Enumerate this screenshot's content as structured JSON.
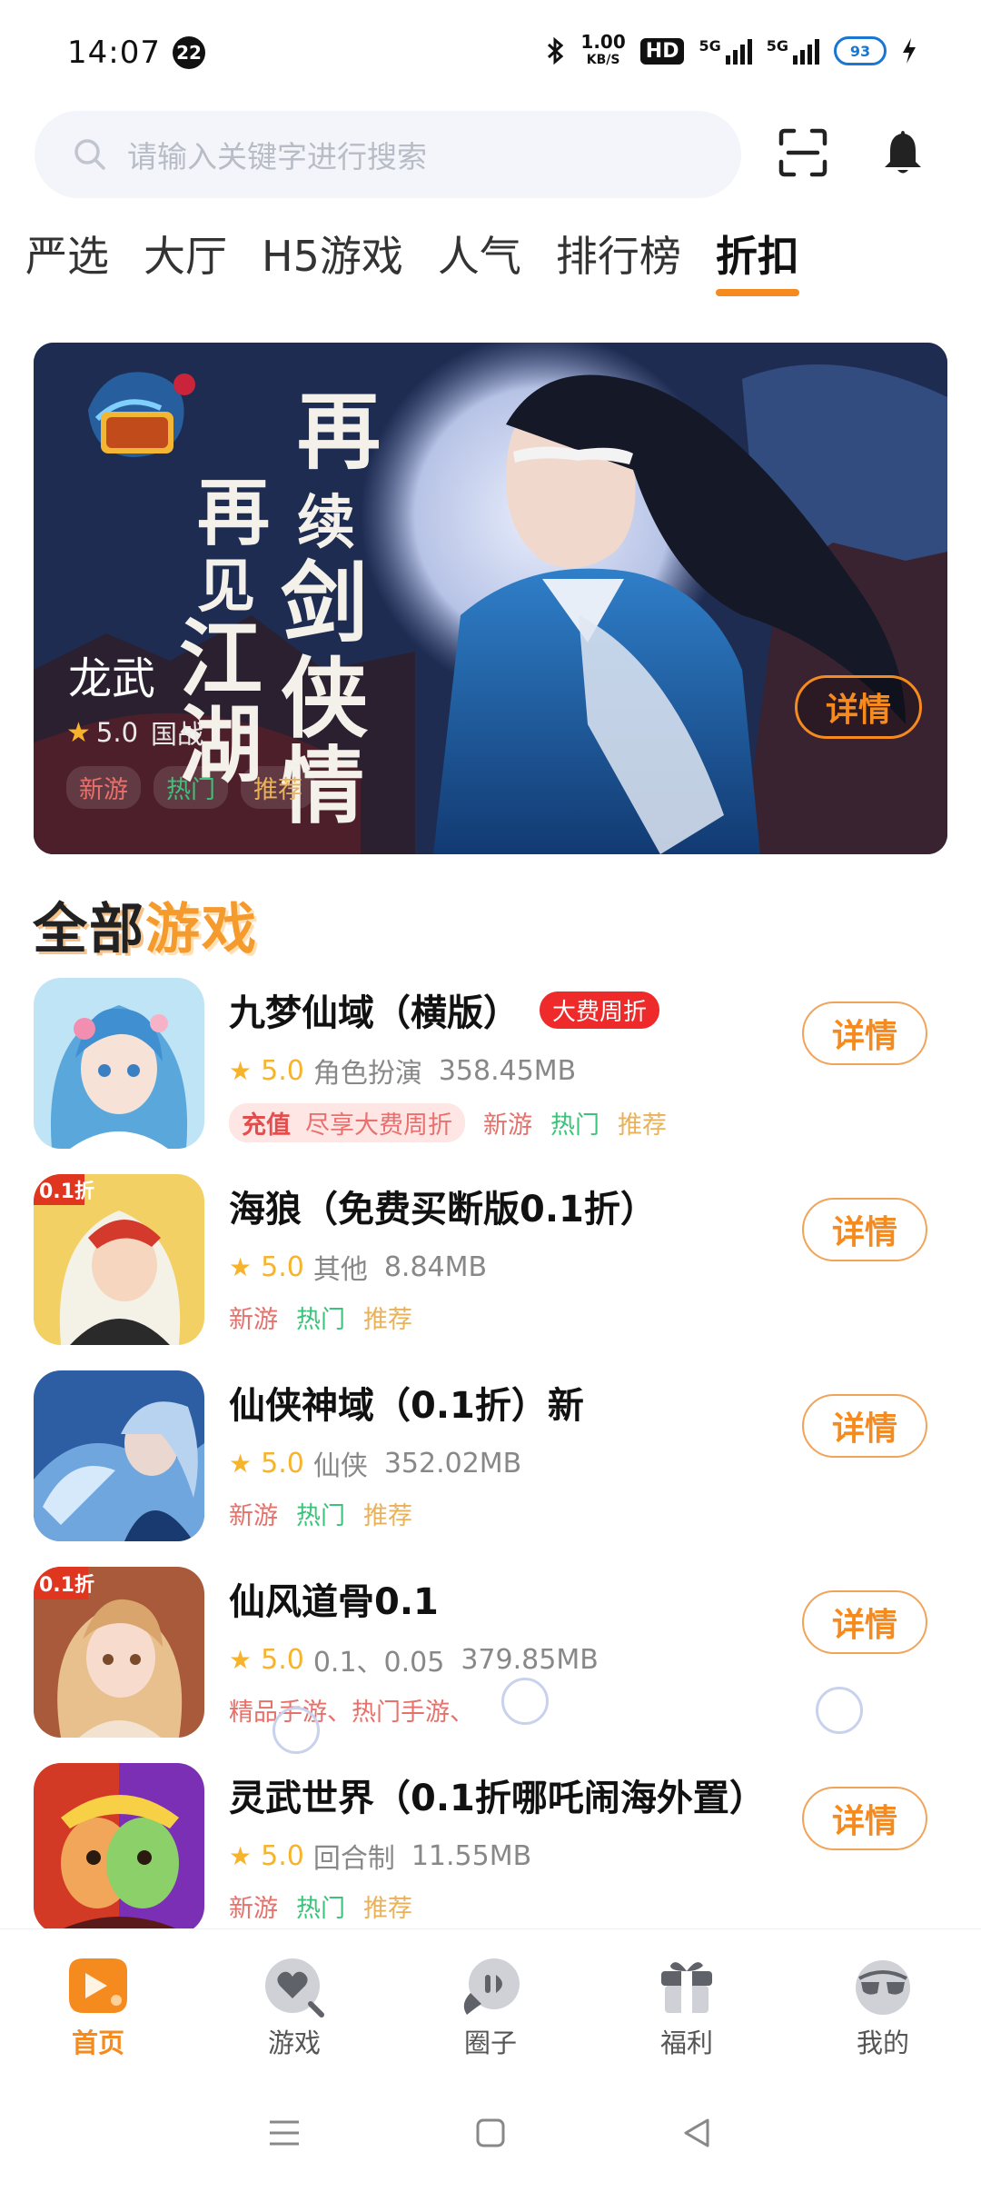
{
  "status_bar": {
    "time": "14:07",
    "notification_count": "22",
    "net_speed_value": "1.00",
    "net_speed_unit": "KB/S",
    "hd_label": "HD",
    "sig1_label": "5G",
    "sig2_label": "5G",
    "cloud_label": "93"
  },
  "search": {
    "placeholder": "请输入关键字进行搜索"
  },
  "tabs": [
    {
      "label": "严选",
      "active": false
    },
    {
      "label": "大厅",
      "active": false
    },
    {
      "label": "H5游戏",
      "active": false
    },
    {
      "label": "人气",
      "active": false
    },
    {
      "label": "排行榜",
      "active": false
    },
    {
      "label": "折扣",
      "active": true
    }
  ],
  "banner": {
    "game_name": "龙武",
    "rating": "5.0",
    "category": "国战",
    "tags": [
      "新游",
      "热门",
      "推荐"
    ],
    "detail_label": "详情"
  },
  "section": {
    "title_part1": "全部",
    "title_part2": "游戏"
  },
  "games": [
    {
      "title": "九梦仙域（横版）",
      "badge": "大费周折",
      "rating": "5.0",
      "category": "角色扮演",
      "size": "358.45MB",
      "pill_a": "充值",
      "pill_b": "尽享大费周折",
      "tags": [
        "新游",
        "热门",
        "推荐"
      ],
      "detail_label": "详情"
    },
    {
      "title": "海狼（免费买断版0.1折）",
      "rating": "5.0",
      "category": "其他",
      "size": "8.84MB",
      "tags": [
        "新游",
        "热门",
        "推荐"
      ],
      "detail_label": "详情"
    },
    {
      "title": "仙侠神域（0.1折）新",
      "rating": "5.0",
      "category": "仙侠",
      "size": "352.02MB",
      "tags": [
        "新游",
        "热门",
        "推荐"
      ],
      "detail_label": "详情"
    },
    {
      "title": "仙风道骨0.1",
      "rating": "5.0",
      "category": "0.1、0.05",
      "size": "379.85MB",
      "plain_tags": "精品手游、热门手游、",
      "detail_label": "详情"
    },
    {
      "title": "灵武世界（0.1折哪吒闹海外置）",
      "rating": "5.0",
      "category": "回合制",
      "size": "11.55MB",
      "tags": [
        "新游",
        "热门",
        "推荐"
      ],
      "detail_label": "详情"
    }
  ],
  "bottom_nav": [
    {
      "label": "首页",
      "active": true
    },
    {
      "label": "游戏",
      "active": false
    },
    {
      "label": "圈子",
      "active": false
    },
    {
      "label": "福利",
      "active": false
    },
    {
      "label": "我的",
      "active": false
    }
  ],
  "colors": {
    "accent": "#f58a1f",
    "badge_red": "#ee2a2a",
    "tag_new": "#e8706a",
    "tag_hot": "#3cc27a",
    "tag_rec": "#e9b25a"
  }
}
